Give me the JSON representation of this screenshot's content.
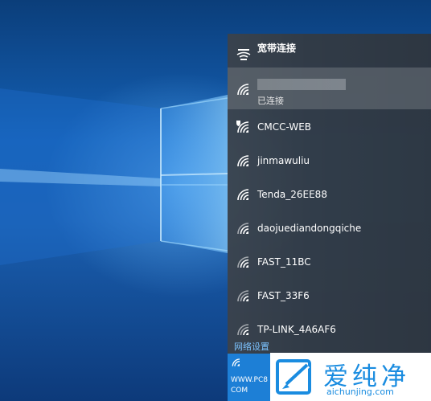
{
  "flyout": {
    "broadband": {
      "label": "宽带连接",
      "icon": "broadband-icon"
    },
    "connected_network": {
      "name": "",
      "status": "已连接",
      "icon": "wifi-icon"
    },
    "networks": [
      {
        "name": "CMCC-WEB",
        "icon": "wifi-open-shield-icon"
      },
      {
        "name": "jinmawuliu",
        "icon": "wifi-secured-icon"
      },
      {
        "name": "Tenda_26EE88",
        "icon": "wifi-secured-icon"
      },
      {
        "name": "daojuediandongqiche",
        "icon": "wifi-secured-icon"
      },
      {
        "name": "FAST_11BC",
        "icon": "wifi-secured-icon"
      },
      {
        "name": "FAST_33F6",
        "icon": "wifi-secured-icon"
      },
      {
        "name": "TP-LINK_4A6AF6",
        "icon": "wifi-secured-icon"
      }
    ],
    "settings_link": "网络设置"
  },
  "tray_tile": {
    "line1": "WWW.PC8",
    "line2": "COM",
    "icon": "wifi-icon"
  },
  "watermark": {
    "brand": "爱纯净",
    "url": "aichunjing.com",
    "accent": "#1a8ce0"
  },
  "colors": {
    "flyout_bg": "#343a42",
    "link": "#7cc3ff",
    "tile": "#1d7fd6"
  }
}
